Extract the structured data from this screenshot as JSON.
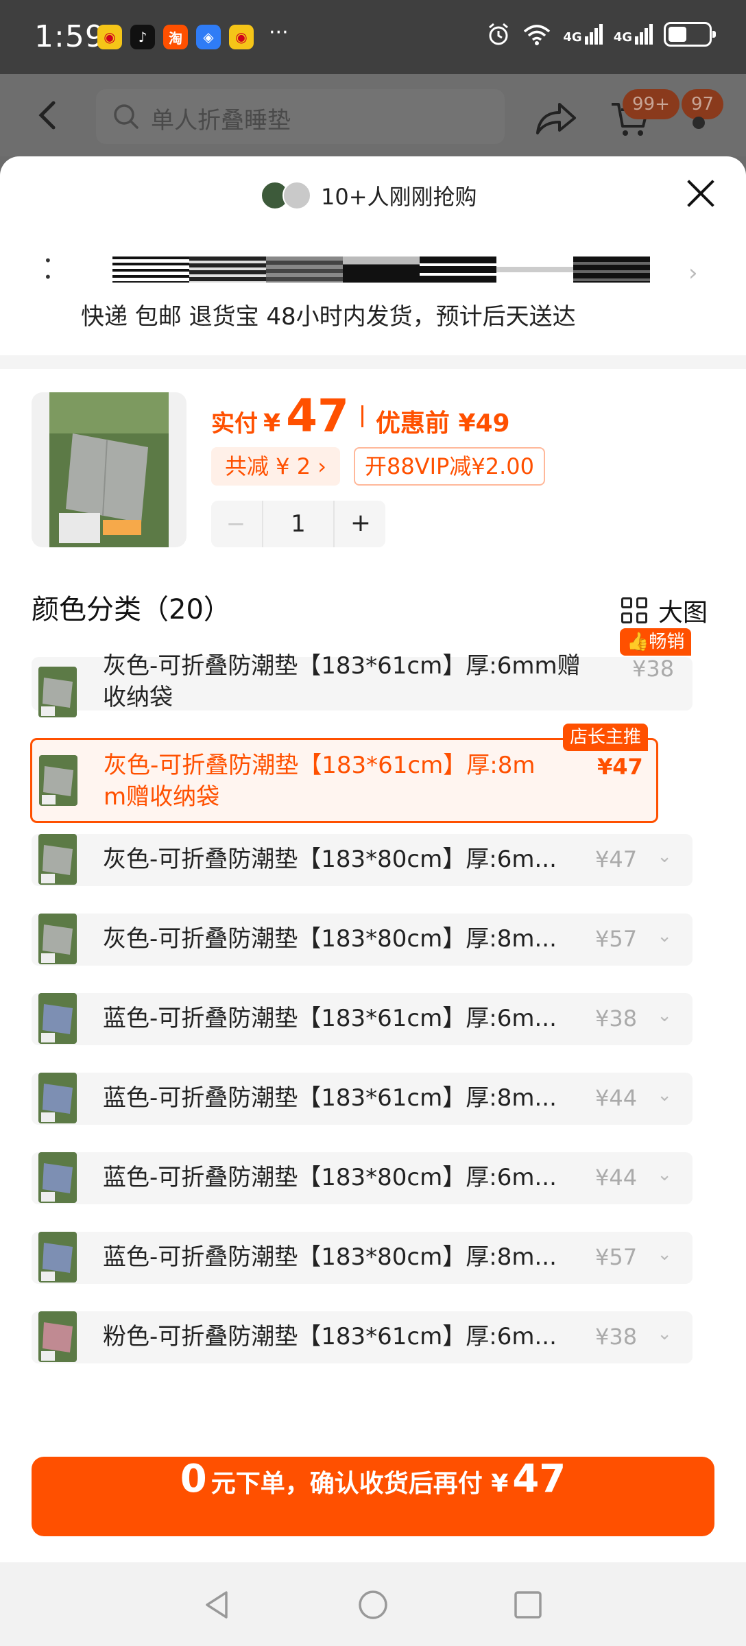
{
  "status_bar": {
    "time": "1:59",
    "dots": "···",
    "network_1": "4G",
    "network_2": "4G"
  },
  "top_nav": {
    "search_placeholder": "单人折叠睡垫",
    "cart_badge": "99+",
    "message_badge": "97"
  },
  "sheet": {
    "buyers_text": "10+人刚刚抢购",
    "shipping_text": "快递 包邮 退货宝 48小时内发货，预计后天送达"
  },
  "price": {
    "label": "实付",
    "yen": "¥",
    "amount": "47",
    "before": "优惠前 ¥49",
    "discount_chip": "共减 ¥ 2 ›",
    "vip_chip": "开88VIP减¥2.00"
  },
  "quantity": {
    "minus": "−",
    "value": "1",
    "plus": "+"
  },
  "section": {
    "title": "颜色分类（20）",
    "grid_toggle": "大图"
  },
  "variants": [
    {
      "label_line1": "灰色-可折叠防潮垫【183*61cm】厚:6mm赠",
      "label_line2": "收纳袋",
      "price": "¥38",
      "tag": "👍畅销",
      "color": "gray"
    },
    {
      "label_line1": "灰色-可折叠防潮垫【183*61cm】厚:8m",
      "label_line2": "m赠收纳袋",
      "price": "¥47",
      "tag": "店长主推",
      "color": "gray",
      "selected": true
    },
    {
      "label_line1": "灰色-可折叠防潮垫【183*80cm】厚:6m...",
      "price": "¥47",
      "color": "gray"
    },
    {
      "label_line1": "灰色-可折叠防潮垫【183*80cm】厚:8m...",
      "price": "¥57",
      "color": "gray"
    },
    {
      "label_line1": "蓝色-可折叠防潮垫【183*61cm】厚:6m...",
      "price": "¥38",
      "color": "blue"
    },
    {
      "label_line1": "蓝色-可折叠防潮垫【183*61cm】厚:8m...",
      "price": "¥44",
      "color": "blue"
    },
    {
      "label_line1": "蓝色-可折叠防潮垫【183*80cm】厚:6m...",
      "price": "¥44",
      "color": "blue"
    },
    {
      "label_line1": "蓝色-可折叠防潮垫【183*80cm】厚:8m...",
      "price": "¥57",
      "color": "blue"
    },
    {
      "label_line1": "粉色-可折叠防潮垫【183*61cm】厚:6m...",
      "price": "¥38",
      "color": "pink"
    }
  ],
  "cta": {
    "big_left": "0",
    "text": "元下单，确认收货后再付 ¥",
    "big_right": "47"
  },
  "colors": {
    "accent": "#ff5000",
    "status_bar": "#3f3f3f"
  }
}
